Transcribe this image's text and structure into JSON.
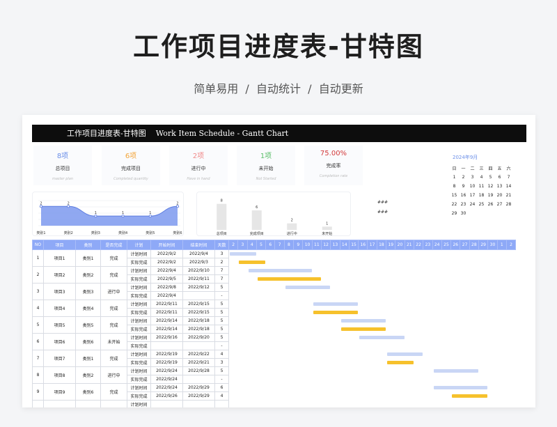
{
  "hero": {
    "title": "工作项目进度表-甘特图",
    "subtitle": "简单易用  /  自动统计  /  自动更新"
  },
  "sheet": {
    "title_cn": "工作项目进度表-甘特图",
    "title_en": "Work Item Schedule - Gantt Chart"
  },
  "kpis": [
    {
      "value": "8项",
      "label": "总项目",
      "en": "master plan",
      "color": "#6b8fe8"
    },
    {
      "value": "6项",
      "label": "完成项目",
      "en": "Completed quantity",
      "color": "#f3a53b"
    },
    {
      "value": "2项",
      "label": "进行中",
      "en": "Have in hand",
      "color": "#f08a8a"
    },
    {
      "value": "1项",
      "label": "未开始",
      "en": "Not Started",
      "color": "#5cbf6a"
    },
    {
      "value": "75.00%",
      "label": "完成率",
      "en": "Completion rate",
      "color": "#d33a3a"
    }
  ],
  "calendar": {
    "title": "2024年9月",
    "weekdays": [
      "日",
      "一",
      "二",
      "三",
      "四",
      "五",
      "六"
    ],
    "weeks": [
      [
        "1",
        "2",
        "3",
        "4",
        "5",
        "6",
        "7"
      ],
      [
        "8",
        "9",
        "10",
        "11",
        "12",
        "13",
        "14"
      ],
      [
        "15",
        "16",
        "17",
        "18",
        "19",
        "20",
        "21"
      ],
      [
        "22",
        "23",
        "24",
        "25",
        "26",
        "27",
        "28"
      ],
      [
        "29",
        "30",
        "",
        "",
        "",
        "",
        ""
      ]
    ]
  },
  "placeholders": [
    "###",
    "###"
  ],
  "chart_data": [
    {
      "type": "area",
      "categories": [
        "类别1",
        "类别2",
        "类别3",
        "类别4",
        "类别5",
        "类别6"
      ],
      "values": [
        2,
        2,
        1,
        1,
        1,
        2
      ],
      "ylim": [
        0,
        2.6
      ],
      "grid": true,
      "color": "#7d99ef"
    },
    {
      "type": "bar",
      "categories": [
        "总项目",
        "完成项目",
        "进行中",
        "未开始"
      ],
      "values": [
        8,
        6,
        2,
        1
      ],
      "ylim": [
        0,
        9
      ],
      "color": "#e6e6e6"
    }
  ],
  "table": {
    "headers": [
      "NO",
      "项目",
      "类别",
      "是否完成",
      "计划",
      "开始时间",
      "结束时间",
      "天数"
    ],
    "day_headers": [
      "2",
      "3",
      "4",
      "5",
      "6",
      "7",
      "8",
      "9",
      "10",
      "11",
      "12",
      "13",
      "14",
      "15",
      "16",
      "17",
      "18",
      "19",
      "20",
      "21",
      "22",
      "23",
      "24",
      "25",
      "26",
      "27",
      "28",
      "29",
      "30",
      "1",
      "2"
    ],
    "plan_label": "计划时间",
    "actual_label": "实际完成",
    "rows": [
      {
        "no": "1",
        "item": "项目1",
        "cat": "类别1",
        "status": "完成",
        "plan": {
          "start": "2022/9/2",
          "end": "2022/9/4",
          "days": "3"
        },
        "actual": {
          "start": "2022/9/2",
          "end": "2022/9/3",
          "days": "2"
        }
      },
      {
        "no": "2",
        "item": "项目2",
        "cat": "类别2",
        "status": "完成",
        "plan": {
          "start": "2022/9/4",
          "end": "2022/9/10",
          "days": "7"
        },
        "actual": {
          "start": "2022/9/5",
          "end": "2022/9/11",
          "days": "7"
        }
      },
      {
        "no": "3",
        "item": "项目3",
        "cat": "类别3",
        "status": "进行中",
        "plan": {
          "start": "2022/9/8",
          "end": "2022/9/12",
          "days": "5"
        },
        "actual": {
          "start": "2022/9/4",
          "end": "",
          "days": "-"
        }
      },
      {
        "no": "4",
        "item": "项目4",
        "cat": "类别4",
        "status": "完成",
        "plan": {
          "start": "2022/9/11",
          "end": "2022/9/15",
          "days": "5"
        },
        "actual": {
          "start": "2022/9/11",
          "end": "2022/9/15",
          "days": "5"
        }
      },
      {
        "no": "5",
        "item": "项目5",
        "cat": "类别5",
        "status": "完成",
        "plan": {
          "start": "2022/9/14",
          "end": "2022/9/18",
          "days": "5"
        },
        "actual": {
          "start": "2022/9/14",
          "end": "2022/9/18",
          "days": "5"
        }
      },
      {
        "no": "6",
        "item": "项目6",
        "cat": "类别6",
        "status": "未开始",
        "plan": {
          "start": "2022/9/16",
          "end": "2022/9/20",
          "days": "5"
        },
        "actual": {
          "start": "",
          "end": "",
          "days": "-"
        }
      },
      {
        "no": "7",
        "item": "项目7",
        "cat": "类别1",
        "status": "完成",
        "plan": {
          "start": "2022/9/19",
          "end": "2022/9/22",
          "days": "4"
        },
        "actual": {
          "start": "2022/9/19",
          "end": "2022/9/21",
          "days": "3"
        }
      },
      {
        "no": "8",
        "item": "项目8",
        "cat": "类别2",
        "status": "进行中",
        "plan": {
          "start": "2022/9/24",
          "end": "2022/9/28",
          "days": "5"
        },
        "actual": {
          "start": "2022/9/24",
          "end": "",
          "days": "-"
        }
      },
      {
        "no": "9",
        "item": "项目9",
        "cat": "类别6",
        "status": "完成",
        "plan": {
          "start": "2022/9/24",
          "end": "2022/9/29",
          "days": "6"
        },
        "actual": {
          "start": "2022/9/26",
          "end": "2022/9/29",
          "days": "4"
        }
      }
    ],
    "partial_label": "计划时间"
  },
  "gantt": {
    "first_day": 2,
    "rows": [
      {
        "plan": [
          2,
          4
        ],
        "actual": [
          3,
          5
        ]
      },
      {
        "plan": [
          4,
          10
        ],
        "actual": [
          5,
          11
        ]
      },
      {
        "plan": [
          8,
          12
        ],
        "actual": null
      },
      {
        "plan": [
          11,
          15
        ],
        "actual": [
          11,
          15
        ]
      },
      {
        "plan": [
          14,
          18
        ],
        "actual": [
          14,
          18
        ]
      },
      {
        "plan": [
          16,
          20
        ],
        "actual": null
      },
      {
        "plan": [
          19,
          22
        ],
        "actual": [
          19,
          21
        ]
      },
      {
        "plan": [
          24,
          28
        ],
        "actual": null
      },
      {
        "plan": [
          24,
          29
        ],
        "actual": [
          26,
          29
        ]
      }
    ]
  }
}
